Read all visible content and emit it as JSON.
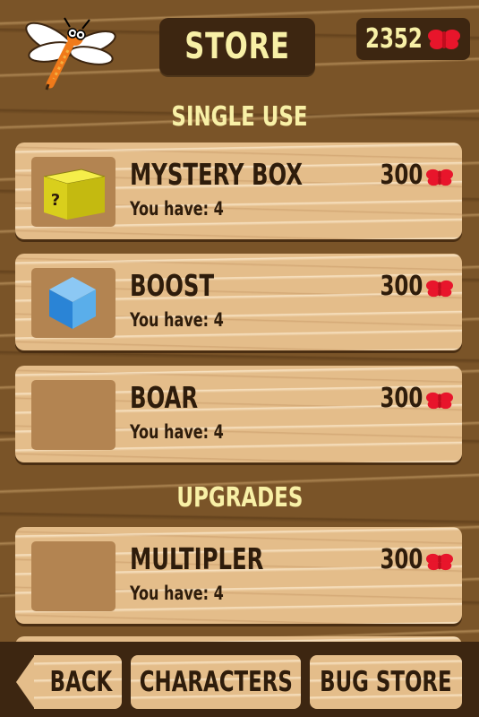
{
  "header": {
    "title": "STORE",
    "currency_amount": "2352",
    "currency_icon": "red-bug-icon",
    "logo_icon": "dragonfly-icon"
  },
  "sections": {
    "single_use": "SINGLE USE",
    "upgrades": "UPGRADES"
  },
  "items": [
    {
      "name": "MYSTERY BOX",
      "owned": "You have: 4",
      "price": "300",
      "icon": "mystery-box-icon"
    },
    {
      "name": "BOOST",
      "owned": "You have: 4",
      "price": "300",
      "icon": "blue-cube-icon"
    },
    {
      "name": "BOAR",
      "owned": "You have: 4",
      "price": "300",
      "icon": ""
    },
    {
      "name": "MULTIPLER",
      "owned": "You have: 4",
      "price": "300",
      "icon": ""
    }
  ],
  "nav": {
    "back": "BACK",
    "characters": "CHARACTERS",
    "bug_store": "BUG STORE"
  },
  "colors": {
    "accent_text": "#f8f0a6",
    "dark_plate": "#3d2611",
    "card_wood": "#e4bd8a",
    "currency_red": "#e8152b"
  }
}
